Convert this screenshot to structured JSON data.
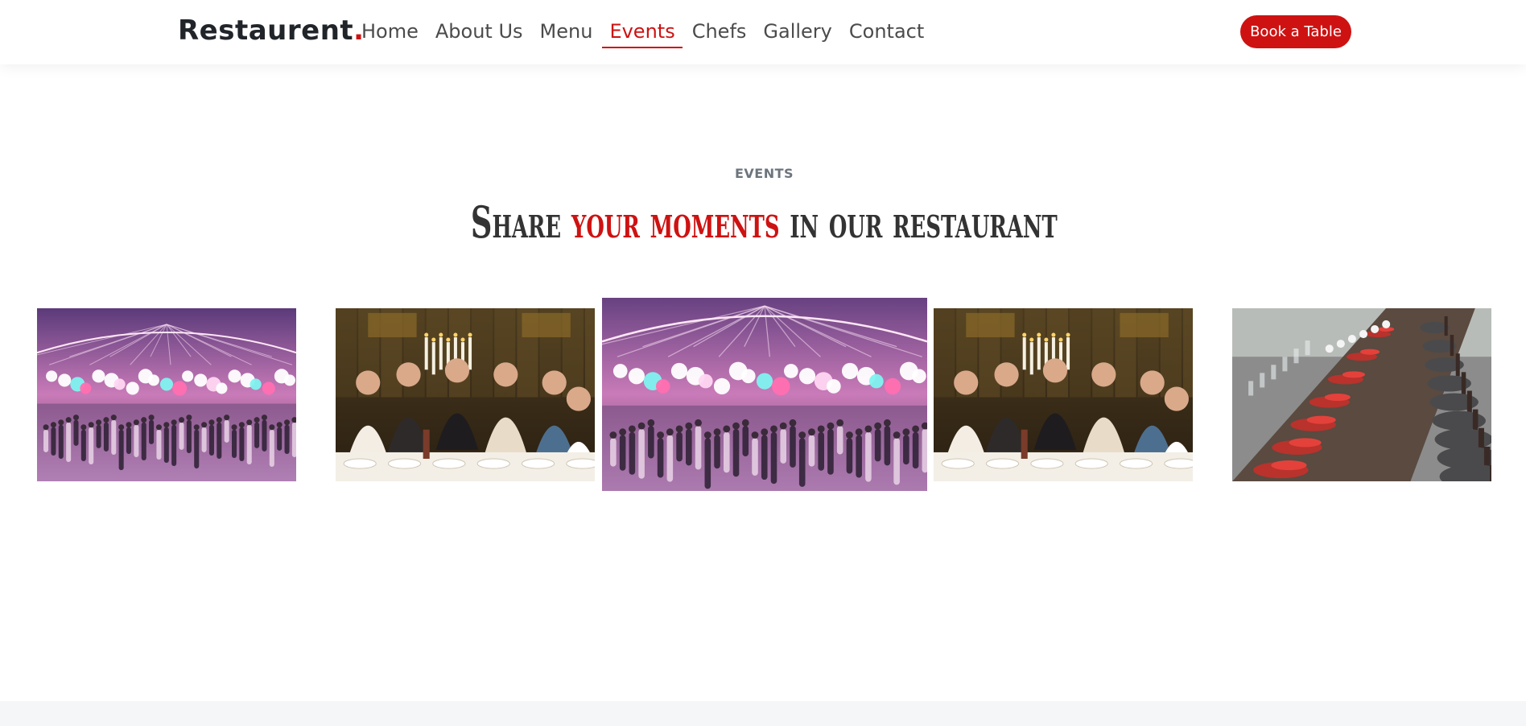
{
  "brand": {
    "name": "Restaurent",
    "dot": "."
  },
  "nav": {
    "items": [
      {
        "label": "Home",
        "active": false
      },
      {
        "label": "About Us",
        "active": false
      },
      {
        "label": "Menu",
        "active": false
      },
      {
        "label": "Events",
        "active": true
      },
      {
        "label": "Chefs",
        "active": false
      },
      {
        "label": "Gallery",
        "active": false
      },
      {
        "label": "Contact",
        "active": false
      }
    ],
    "cta": "Book a Table"
  },
  "events": {
    "tag": "EVENTS",
    "title_pre": "Share",
    "title_accent": "your moments",
    "title_post": "in our restaurant"
  },
  "gallery": {
    "items": [
      {
        "scene": "party-venue",
        "active": false
      },
      {
        "scene": "dinner-toast",
        "active": false
      },
      {
        "scene": "party-venue",
        "active": true
      },
      {
        "scene": "dinner-toast",
        "active": false
      },
      {
        "scene": "table-setting",
        "active": false
      }
    ]
  },
  "colors": {
    "accent": "#ce1212",
    "text": "#212529",
    "muted": "#6c757d",
    "footer_bg": "#f5f6f8"
  }
}
